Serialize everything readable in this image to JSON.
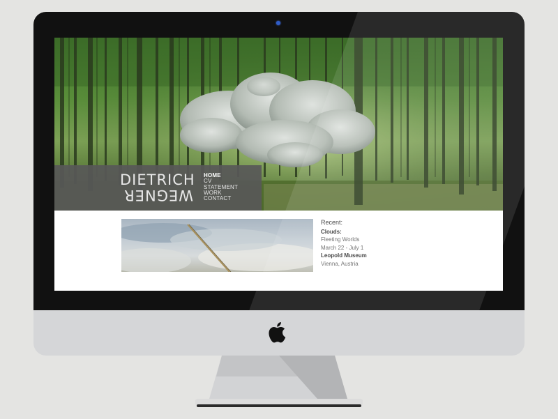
{
  "site": {
    "logo_top": "DIETRICH",
    "logo_bottom": "WEGNER",
    "nav": [
      {
        "label": "HOME",
        "active": true
      },
      {
        "label": "CV",
        "active": false
      },
      {
        "label": "STATEMENT",
        "active": false
      },
      {
        "label": "WORK",
        "active": false
      },
      {
        "label": "CONTACT",
        "active": false
      }
    ],
    "recent": {
      "heading": "Recent:",
      "title": "Clouds:",
      "subtitle": "Fleeting Worlds",
      "dates": "March 22 - July 1",
      "venue": "Leopold Museum",
      "location": "Vienna, Austria"
    }
  },
  "device": {
    "apple_logo_icon": "apple-logo-icon",
    "camera_color": "#2f5cc7",
    "bezel_color": "#111111",
    "chin_color": "#d5d6d8"
  }
}
